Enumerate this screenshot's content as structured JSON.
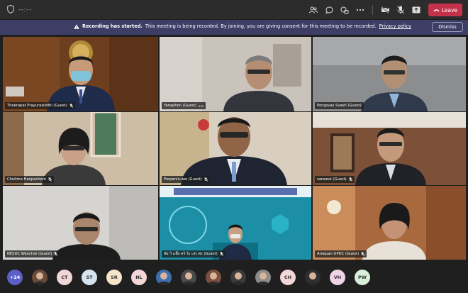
{
  "topbar": {
    "timer": "--:--",
    "leave_label": "Leave",
    "colors": {
      "leave": "#c4314b",
      "bar": "#2d2c2c"
    }
  },
  "banner": {
    "title": "Recording has started.",
    "message": "This meeting is being recorded. By joining, you are giving consent for this meeting to be recorded.",
    "link": "Privacy policy",
    "dismiss": "Dismiss"
  },
  "participants": [
    {
      "name": "Theerapat Prayurasiddhi (Guest)",
      "icon": "mic-off-icon"
    },
    {
      "name": "Yanaphon (Guest)",
      "icon": "more-icon"
    },
    {
      "name": "Pongsvas Svasti (Guest)",
      "icon": "mic-off-icon"
    },
    {
      "name": "Chutima Hanpachern",
      "icon": "mic-off-icon"
    },
    {
      "name": "Porpanin.ww (Guest)",
      "icon": "mic-off-icon"
    },
    {
      "name": "sarawut (Guest)",
      "icon": "mic-off-icon"
    },
    {
      "name": "NESDC Wanchat (Guest)",
      "icon": "mic-off-icon"
    },
    {
      "name": "ชัย วิ แจ๊ส ควิ ร้ะ เจ่ร พร (Guest)",
      "icon": "mic-off-icon"
    },
    {
      "name": "Areepan OPDC (Guest)",
      "icon": "mic-off-icon"
    }
  ],
  "roster": {
    "more_count": "+24",
    "avatars": [
      {
        "initials": "",
        "kind": "photo",
        "color": "#6a4a3a"
      },
      {
        "initials": "CT",
        "kind": "initials",
        "color": "#f3d6d8"
      },
      {
        "initials": "ST",
        "kind": "initials",
        "color": "#d6e4f0"
      },
      {
        "initials": "SR",
        "kind": "initials",
        "color": "#f6e6c9"
      },
      {
        "initials": "NL",
        "kind": "initials",
        "color": "#f3d6d8"
      },
      {
        "initials": "",
        "kind": "photo",
        "color": "#3f6fb0"
      },
      {
        "initials": "",
        "kind": "photo",
        "color": "#4a4a4a"
      },
      {
        "initials": "",
        "kind": "photo",
        "color": "#7a5040"
      },
      {
        "initials": "",
        "kind": "photo",
        "color": "#3b3b3b"
      },
      {
        "initials": "",
        "kind": "photo",
        "color": "#8c8c8c"
      },
      {
        "initials": "CH",
        "kind": "initials",
        "color": "#f3d6d8"
      },
      {
        "initials": "",
        "kind": "photo",
        "color": "#2f2f2f"
      },
      {
        "initials": "VH",
        "kind": "initials",
        "color": "#f1d3e8"
      },
      {
        "initials": "PW",
        "kind": "initials",
        "color": "#d9efd9"
      }
    ]
  }
}
